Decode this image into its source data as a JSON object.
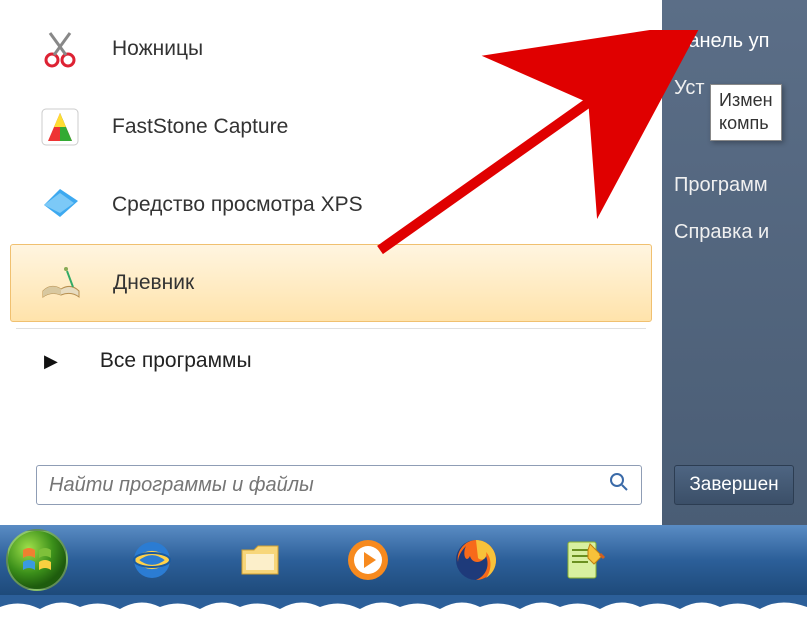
{
  "programs": [
    {
      "label": "Ножницы",
      "icon": "scissors-icon"
    },
    {
      "label": "FastStone Capture",
      "icon": "faststone-icon"
    },
    {
      "label": "Средство просмотра XPS",
      "icon": "xps-icon"
    },
    {
      "label": "Дневник",
      "icon": "journal-icon",
      "selected": true
    }
  ],
  "all_programs_label": "Все программы",
  "search": {
    "placeholder": "Найти программы и файлы"
  },
  "right": {
    "control_panel": "Панель уп",
    "devices": "Уст",
    "tooltip_line1": "Измен",
    "tooltip_line2": "компь",
    "default_programs": "Программ",
    "help": "Справка и",
    "shutdown": "Завершен"
  },
  "taskbar": {
    "items": [
      "start",
      "ie",
      "explorer",
      "wmp",
      "firefox",
      "notepadpp"
    ]
  }
}
